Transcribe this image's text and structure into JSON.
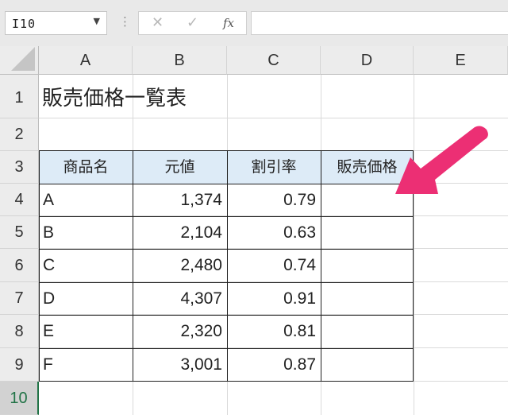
{
  "name_box": {
    "value": "I10"
  },
  "formula_bar": {
    "cancel_glyph": "✕",
    "enter_glyph": "✓",
    "fx_label": "fx",
    "separator": "⋮",
    "content": ""
  },
  "columns": [
    "A",
    "B",
    "C",
    "D",
    "E"
  ],
  "rows": [
    "1",
    "2",
    "3",
    "4",
    "5",
    "6",
    "7",
    "8",
    "9",
    "10"
  ],
  "selected_row": "10",
  "sheet": {
    "title": "販売価格一覧表",
    "headers": [
      "商品名",
      "元値",
      "割引率",
      "販売価格"
    ],
    "records": [
      {
        "name": "A",
        "price": "1,374",
        "rate": "0.79",
        "sale": ""
      },
      {
        "name": "B",
        "price": "2,104",
        "rate": "0.63",
        "sale": ""
      },
      {
        "name": "C",
        "price": "2,480",
        "rate": "0.74",
        "sale": ""
      },
      {
        "name": "D",
        "price": "4,307",
        "rate": "0.91",
        "sale": ""
      },
      {
        "name": "E",
        "price": "2,320",
        "rate": "0.81",
        "sale": ""
      },
      {
        "name": "F",
        "price": "3,001",
        "rate": "0.87",
        "sale": ""
      }
    ]
  },
  "colors": {
    "header_fill": "#ddebf7",
    "arrow": "#ec2f74",
    "selection_accent": "#217346"
  },
  "annotation": {
    "icon": "pointer-arrow-icon"
  }
}
